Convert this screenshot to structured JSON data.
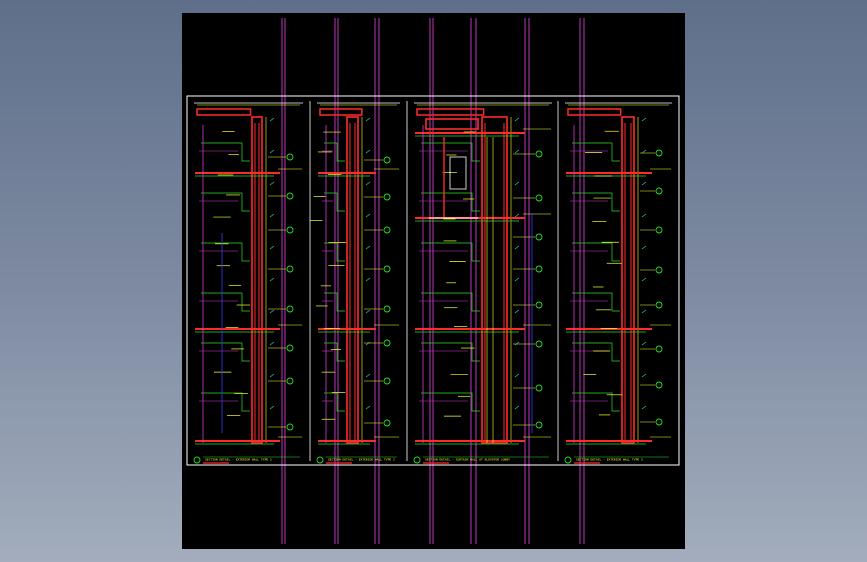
{
  "viewer": {
    "background": "#000000",
    "desktop_gradient_top": "#5f6f8a",
    "desktop_gradient_bottom": "#a3adbd"
  },
  "colors": {
    "frame": "#ffffff",
    "wall": "#ff2a2a",
    "grid": "#d23cd2",
    "green": "#25e025",
    "yellow": "#ffff30",
    "cyan": "#33dddd",
    "blue": "#3a3aff"
  },
  "panels": [
    {
      "id": "A",
      "caption": "SECTION DETAIL - EXTERIOR WALL TYPE 1"
    },
    {
      "id": "B",
      "caption": "SECTION DETAIL - EXTERIOR WALL TYPE 2"
    },
    {
      "id": "C",
      "caption": "SECTION DETAIL - CURTAIN WALL AT ELEVATOR LOBBY"
    },
    {
      "id": "D",
      "caption": "SECTION DETAIL - EXTERIOR WALL TYPE 3"
    }
  ]
}
